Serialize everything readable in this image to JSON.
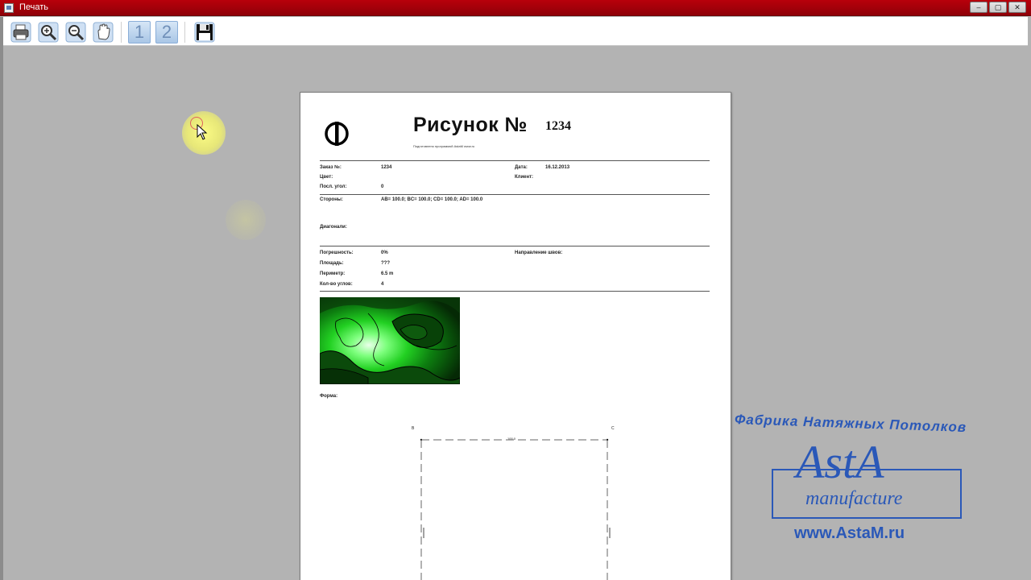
{
  "window": {
    "title": "Печать",
    "controls": [
      "–",
      "▢",
      "✕"
    ]
  },
  "toolbar": {
    "buttons": [
      {
        "name": "print-button",
        "icon": "printer-icon"
      },
      {
        "name": "zoom-in-button",
        "icon": "zoom-in-icon"
      },
      {
        "name": "zoom-out-button",
        "icon": "zoom-out-icon"
      },
      {
        "name": "pan-button",
        "icon": "hand-icon"
      }
    ],
    "page_one_label": "1",
    "page_two_label": "2",
    "save_icon": "floppy-disk-icon"
  },
  "document": {
    "title": "Рисунок №",
    "number": "1234",
    "subtitle": "Подготовлено программой AstaM  www.ru",
    "order_label": "Заказ №:",
    "order_value": "1234",
    "date_label": "Дата:",
    "date_value": "16.12.2013",
    "color_label": "Цвет:",
    "client_label": "Клиент:",
    "last_angle_label": "Посл. угол:",
    "last_angle_value": "0",
    "sides_label": "Стороны:",
    "sides_value": "AB= 100.0; BC= 100.0; CD= 100.0; AD= 100.0",
    "diagonals_label": "Диагонали:",
    "error_label": "Погрешность:",
    "error_value": "0%",
    "seam_label": "Направление швов:",
    "area_label": "Площадь:",
    "area_value": "???",
    "perimeter_label": "Периметр:",
    "perimeter_value": "6.5 m",
    "corners_label": "Кол-во углов:",
    "corners_value": "4",
    "shape_label": "Форма:",
    "vertex_b": "B",
    "vertex_c": "C",
    "edge_label": "100.0"
  },
  "watermark": {
    "line1": "Фабрика Натяжных Потолков",
    "brand": "AstA",
    "sub": "manufacture",
    "url": "www.AstaM.ru"
  },
  "colors": {
    "titlebar": "#a8000a",
    "accent": "#2a58b8",
    "background": "#b3b3b3"
  }
}
